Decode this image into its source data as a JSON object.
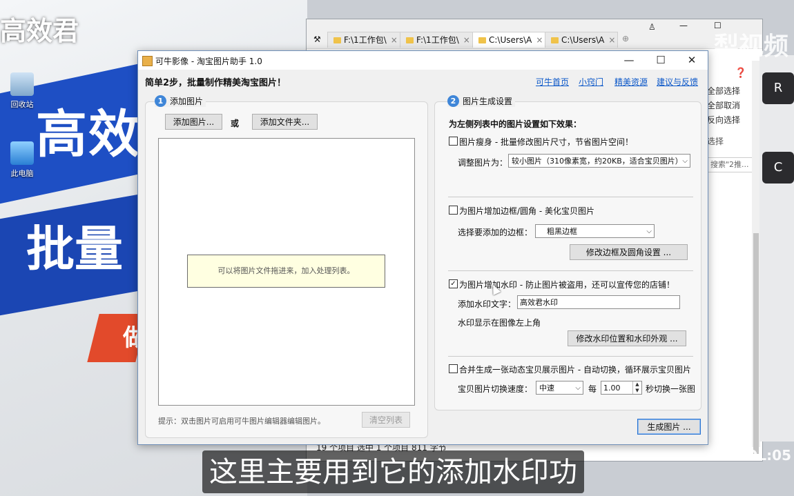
{
  "background": {
    "channel_logo": "高效君",
    "banner_text_1": "高效",
    "banner_text_2": "批量",
    "banner_text_3": "做",
    "desktop_icons": [
      {
        "label": "回收站"
      },
      {
        "label": "此电脑"
      }
    ],
    "keyboard_keys": [
      "R",
      "C"
    ],
    "site_watermark": "梨视频",
    "volume_tag": "VOL:05"
  },
  "explorer": {
    "tabs": [
      {
        "label": "F:\\1工作包\\"
      },
      {
        "label": "F:\\1工作包\\"
      },
      {
        "label": "C:\\Users\\A"
      },
      {
        "label": "C:\\Users\\A"
      }
    ],
    "side_actions": [
      "全部选择",
      "全部取消",
      "反向选择",
      "选择"
    ],
    "search_placeholder": "搜索\"2推...",
    "status": "19 个项目    选中 1 个项目  811 字节"
  },
  "dialog": {
    "title": "可牛影像 - 淘宝图片助手 1.0",
    "heading": "简单2步，批量制作精美淘宝图片！",
    "links": [
      "可牛首页",
      "小窍门",
      "精美资源",
      "建议与反馈"
    ],
    "left": {
      "step_num": "1",
      "step_title": "添加图片",
      "add_images": "添加图片...",
      "or": "或",
      "add_folder": "添加文件夹...",
      "drop_hint": "可以将图片文件拖进来，加入处理列表。",
      "tip": "提示：双击图片可启用可牛图片编辑器编辑图片。",
      "clear_list": "清空列表"
    },
    "right": {
      "step_num": "2",
      "step_title": "图片生成设置",
      "intro": "为左侧列表中的图片设置如下效果：",
      "slim": {
        "checked": false,
        "label": "图片瘦身 - 批量修改图片尺寸，节省图片空间！",
        "resize_label": "调整图片为：",
        "resize_value": "较小图片（310像素宽，约20KB，适合宝贝图片）"
      },
      "border": {
        "checked": false,
        "label": "为图片增加边框/圆角 - 美化宝贝图片",
        "select_label": "选择要添加的边框：",
        "select_value": "粗黑边框",
        "settings_btn": "修改边框及圆角设置 ..."
      },
      "watermark": {
        "checked": true,
        "label": "为图片增加水印 - 防止图片被盗用，还可以宣传您的店铺！",
        "text_label": "添加水印文字：",
        "text_value": "高效君水印",
        "position_text": "水印显示在图像左上角",
        "settings_btn": "修改水印位置和水印外观 ..."
      },
      "animate": {
        "checked": false,
        "label": "合并生成一张动态宝贝展示图片 - 自动切换，循环展示宝贝图片",
        "speed_label": "宝贝图片切换速度：",
        "speed_value": "中速",
        "every": "每",
        "seconds_value": "1.00",
        "suffix": "秒切换一张图"
      }
    },
    "generate_btn": "生成图片 ..."
  },
  "subtitle": "这里主要用到它的添加水印功"
}
